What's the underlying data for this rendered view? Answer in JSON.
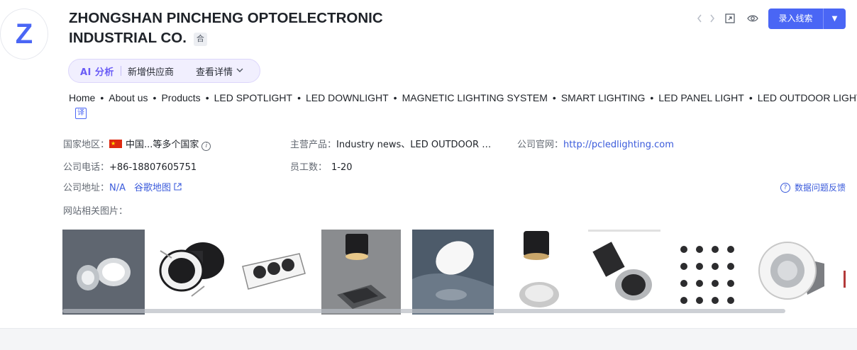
{
  "company": {
    "avatar_letter": "Z",
    "name": "ZHONGSHAN PINCHENG OPTOELECTRONIC INDUSTRIAL CO.",
    "tag": "合"
  },
  "actions": {
    "prev_icon": "chevron-left-icon",
    "next_icon": "chevron-right-icon",
    "expand_icon": "expand-icon",
    "view_icon": "eye-icon",
    "primary_label": "录入线索",
    "dropdown_icon": "caret-down-icon"
  },
  "ai": {
    "label": "AI 分析",
    "text": "新增供应商",
    "detail": "查看详情"
  },
  "nav": {
    "items": [
      "Home",
      "About us",
      "Products",
      "LED SPOTLIGHT",
      "LED DOWNLIGHT",
      "MAGNETIC LIGHTING SYSTEM",
      "SMART LIGHTING",
      "LED PANEL LIGHT",
      "LED OUTDOOR LIGHT."
    ],
    "translate_label": "译"
  },
  "info": {
    "country_key": "国家地区：",
    "country_value": "中国...等多个国家",
    "products_key": "主营产品：",
    "products_value": "Industry news、LED OUTDOOR …",
    "website_key": "公司官网：",
    "website_value": "http://pcledlighting.com",
    "phone_key": "公司电话：",
    "phone_value": "+86-18807605751",
    "employees_key": "员工数：",
    "employees_value": "1-20",
    "address_key": "公司地址：",
    "address_value": "N/A",
    "map_label": "谷歌地图",
    "images_key": "网站相关图片：",
    "feedback_label": "数据问题反馈"
  },
  "colors": {
    "accent": "#4a66f5",
    "link": "#3b5bdb",
    "ai_purple": "#6a5cf6"
  }
}
